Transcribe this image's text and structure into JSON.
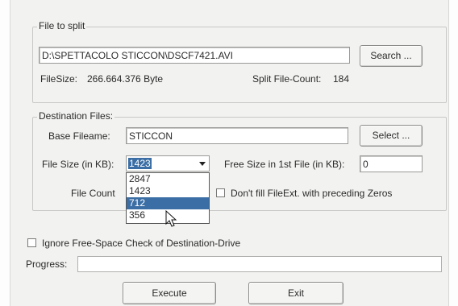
{
  "file_to_split": {
    "legend": "File to split",
    "path_value": "D:\\SPETTACOLO STICCON\\DSCF7421.AVI",
    "search_label": "Search ...",
    "filesize_label": "FileSize:",
    "filesize_value": "266.664.376 Byte",
    "split_count_label": "Split File-Count:",
    "split_count_value": "184"
  },
  "destination": {
    "legend": "Destination Files:",
    "base_label": "Base Fileame:",
    "base_value": "STICCON",
    "select_label": "Select ...",
    "filesize_label": "File Size (in KB):",
    "filesize_selected": "1423",
    "filesize_options": [
      "2847",
      "1423",
      "712",
      "356"
    ],
    "filesize_highlight_index": 2,
    "free_size_label": "Free Size in 1st File (in KB):",
    "free_size_value": "0",
    "file_count_label": "File Count",
    "dont_fill_label": "Don't fill FileExt. with preceding Zeros"
  },
  "ignore_free_space_label": "Ignore Free-Space Check of Destination-Drive",
  "progress_label": "Progress:",
  "execute_label": "Execute",
  "exit_label": "Exit"
}
